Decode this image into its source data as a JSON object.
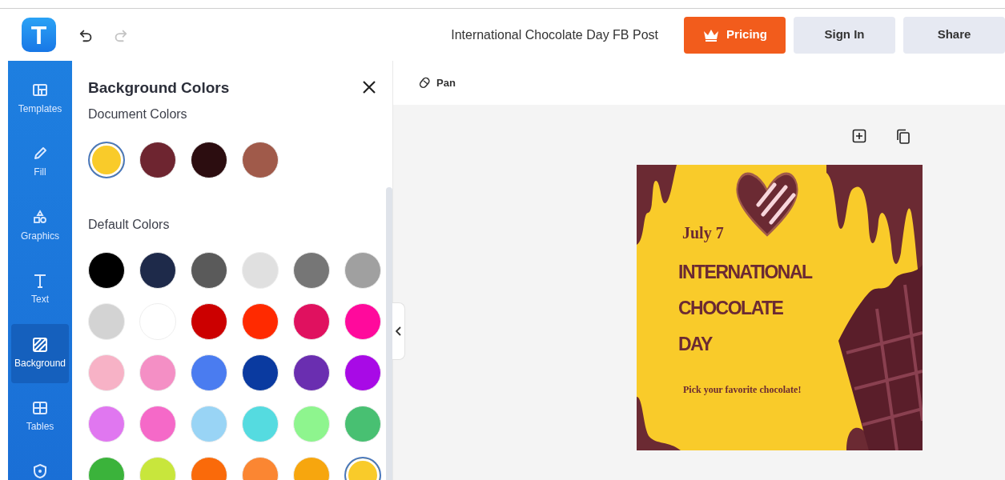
{
  "logo": {
    "letter": "T"
  },
  "history": [
    {
      "kind": "undo",
      "disabled": false
    },
    {
      "kind": "redo",
      "disabled": true
    }
  ],
  "document_title": "International Chocolate Day FB Post",
  "buttons": [
    {
      "kind": "pricing",
      "label": "Pricing"
    },
    {
      "kind": "plain",
      "label": "Sign In"
    },
    {
      "kind": "plain",
      "label": "Share"
    }
  ],
  "sidebar": {
    "items": [
      {
        "kind": "templates",
        "label": "Templates",
        "selected": false
      },
      {
        "kind": "fill",
        "label": "Fill",
        "selected": false
      },
      {
        "kind": "graphics",
        "label": "Graphics",
        "selected": false
      },
      {
        "kind": "text",
        "label": "Text",
        "selected": false
      },
      {
        "kind": "background",
        "label": "Background",
        "selected": true
      },
      {
        "kind": "tables",
        "label": "Tables",
        "selected": false
      },
      {
        "kind": "shield",
        "selected": false
      }
    ]
  },
  "panel": {
    "title": "Background Colors",
    "document_colors_label": "Document Colors",
    "document_colors": [
      {
        "color": "#f9cb2a",
        "selected": true
      },
      {
        "color": "#6e2530",
        "selected": false
      },
      {
        "color": "#2c0d10",
        "selected": false
      },
      {
        "color": "#a05a4a",
        "selected": false
      }
    ],
    "default_colors_label": "Default Colors",
    "default_colors": [
      {
        "color": "#000000",
        "selected": false
      },
      {
        "color": "#1e2a4a",
        "selected": false
      },
      {
        "color": "#5a5a5a",
        "selected": false
      },
      {
        "color": "#e0e0e0",
        "selected": false
      },
      {
        "color": "#767676",
        "selected": false
      },
      {
        "color": "#a0a0a0",
        "selected": false
      },
      {
        "color": "#d3d3d3",
        "selected": false
      },
      {
        "color": "#ffffff",
        "selected": false
      },
      {
        "color": "#cc0000",
        "selected": false
      },
      {
        "color": "#ff2a00",
        "selected": false
      },
      {
        "color": "#e0115f",
        "selected": false
      },
      {
        "color": "#ff0a9c",
        "selected": false
      },
      {
        "color": "#f7b2c6",
        "selected": false
      },
      {
        "color": "#f48fc5",
        "selected": false
      },
      {
        "color": "#4a7cf0",
        "selected": false
      },
      {
        "color": "#0a3aa0",
        "selected": false
      },
      {
        "color": "#6a2eb0",
        "selected": false
      },
      {
        "color": "#a80ae6",
        "selected": false
      },
      {
        "color": "#e077f0",
        "selected": false
      },
      {
        "color": "#f569c8",
        "selected": false
      },
      {
        "color": "#99d4f5",
        "selected": false
      },
      {
        "color": "#55dbe0",
        "selected": false
      },
      {
        "color": "#8ef58e",
        "selected": false
      },
      {
        "color": "#48c072",
        "selected": false
      },
      {
        "color": "#3bb33b",
        "selected": false
      },
      {
        "color": "#c8e63c",
        "selected": false
      },
      {
        "color": "#fa6a0a",
        "selected": false
      },
      {
        "color": "#fb8632",
        "selected": false
      },
      {
        "color": "#f7a60e",
        "selected": false
      },
      {
        "color": "#f9cb2a",
        "selected": true
      }
    ]
  },
  "canvas_toolbar": {
    "pan_label": "Pan"
  },
  "design": {
    "date": "July 7",
    "headline_lines": [
      "INTERNATIONAL",
      "CHOCOLATE",
      "DAY"
    ],
    "tagline": "Pick your favorite chocolate!"
  }
}
